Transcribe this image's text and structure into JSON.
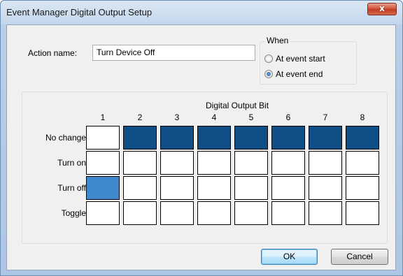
{
  "window": {
    "title": "Event Manager Digital Output Setup",
    "close_glyph": "x"
  },
  "form": {
    "action_label": "Action name:",
    "action_value": "Turn Device Off"
  },
  "when": {
    "legend": "When",
    "options": [
      {
        "label": "At event start",
        "checked": false
      },
      {
        "label": "At event end",
        "checked": true
      }
    ]
  },
  "grid": {
    "title": "Digital Output Bit",
    "columns": [
      "1",
      "2",
      "3",
      "4",
      "5",
      "6",
      "7",
      "8"
    ],
    "rows": [
      "No change",
      "Turn on",
      "Turn off",
      "Toggle"
    ],
    "selection": [
      "Turn off",
      "No change",
      "No change",
      "No change",
      "No change",
      "No change",
      "No change",
      "No change"
    ]
  },
  "buttons": {
    "ok": "OK",
    "cancel": "Cancel"
  },
  "colors": {
    "selected": "#0f4f85",
    "selected_focus": "#3f88cf"
  }
}
